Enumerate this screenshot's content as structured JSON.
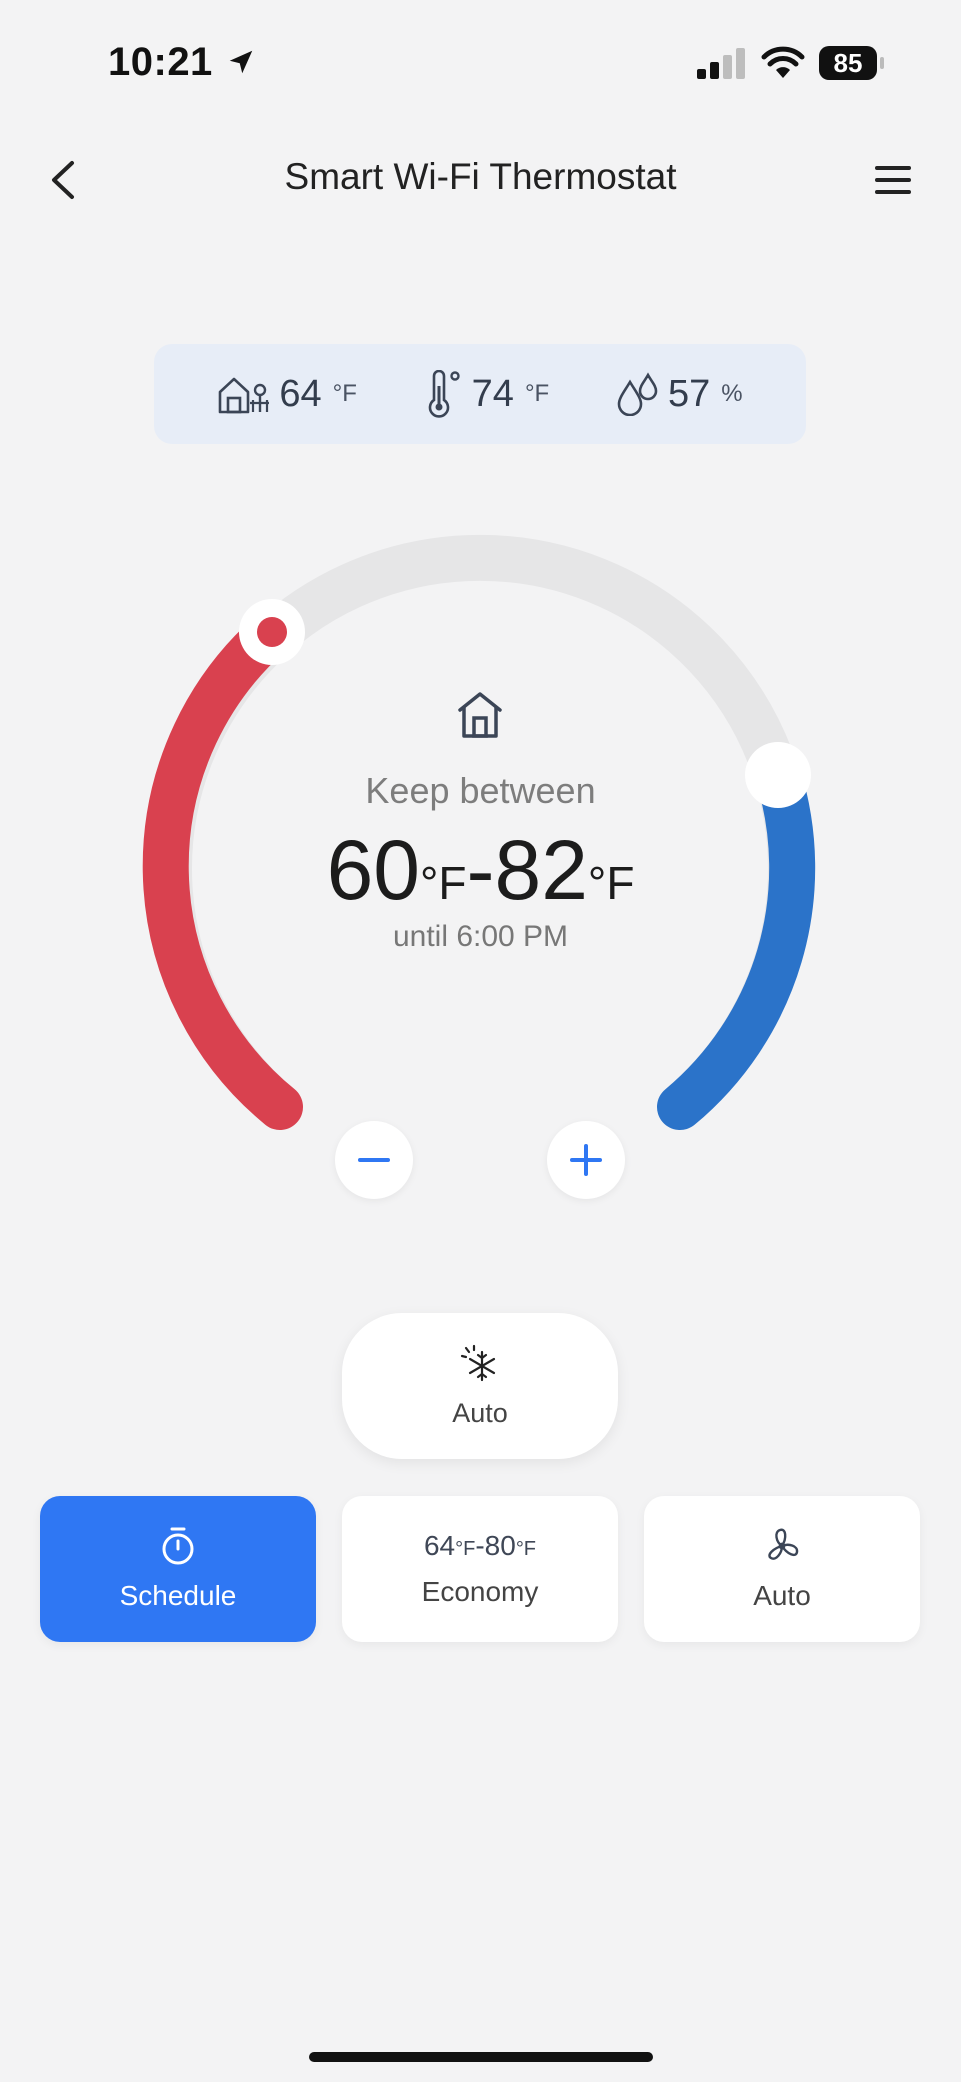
{
  "status_bar": {
    "time": "10:21",
    "battery": "85"
  },
  "header": {
    "title": "Smart Wi-Fi Thermostat"
  },
  "sensors": {
    "outdoor": {
      "value": "64",
      "unit": "°F"
    },
    "indoor": {
      "value": "74",
      "unit": "°F"
    },
    "humidity": {
      "value": "57",
      "unit": "%"
    }
  },
  "dial": {
    "label": "Keep between",
    "low": "60",
    "high": "82",
    "unit": "°F",
    "separator": "-",
    "until": "until 6:00 PM",
    "heat_color": "#d9414f",
    "cool_color": "#2b73c9",
    "track_color": "#e6e6e7"
  },
  "mode": {
    "label": "Auto",
    "icon": "snowflake-sun-icon"
  },
  "tiles": {
    "schedule": {
      "label": "Schedule",
      "icon": "timer-icon"
    },
    "economy": {
      "low": "64",
      "high": "80",
      "unit": "°F",
      "separator": "-",
      "label": "Economy"
    },
    "fan": {
      "label": "Auto",
      "icon": "fan-icon"
    }
  },
  "colors": {
    "accent": "#2f77f3",
    "background": "#f3f3f4"
  }
}
